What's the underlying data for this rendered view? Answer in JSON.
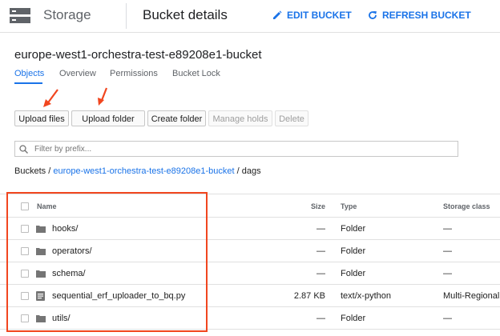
{
  "topbar": {
    "product_icon": "storage-icon",
    "product_label": "Storage",
    "page_title": "Bucket details",
    "edit_label": "EDIT BUCKET",
    "refresh_label": "REFRESH BUCKET"
  },
  "bucket": {
    "name": "europe-west1-orchestra-test-e89208e1-bucket"
  },
  "tabs": [
    {
      "label": "Objects",
      "active": true
    },
    {
      "label": "Overview",
      "active": false
    },
    {
      "label": "Permissions",
      "active": false
    },
    {
      "label": "Bucket Lock",
      "active": false
    }
  ],
  "actions": {
    "upload_files": "Upload files",
    "upload_folder": "Upload folder",
    "create_folder": "Create folder",
    "manage_holds": "Manage holds",
    "delete": "Delete"
  },
  "filter": {
    "placeholder": "Filter by prefix..."
  },
  "breadcrumb": {
    "root": "Buckets",
    "sep": "/",
    "bucket": "europe-west1-orchestra-test-e89208e1-bucket",
    "current": "dags"
  },
  "table": {
    "headers": {
      "name": "Name",
      "size": "Size",
      "type": "Type",
      "storage_class": "Storage class"
    },
    "rows": [
      {
        "icon": "folder-icon",
        "name": "hooks/",
        "size": "—",
        "type": "Folder",
        "storage_class": "—"
      },
      {
        "icon": "folder-icon",
        "name": "operators/",
        "size": "—",
        "type": "Folder",
        "storage_class": "—"
      },
      {
        "icon": "folder-icon",
        "name": "schema/",
        "size": "—",
        "type": "Folder",
        "storage_class": "—"
      },
      {
        "icon": "file-icon",
        "name": "sequential_erf_uploader_to_bq.py",
        "size": "2.87 KB",
        "type": "text/x-python",
        "storage_class": "Multi-Regional"
      },
      {
        "icon": "folder-icon",
        "name": "utils/",
        "size": "—",
        "type": "Folder",
        "storage_class": "—"
      }
    ]
  },
  "colors": {
    "accent": "#1a73e8",
    "annotation": "#f1461f"
  }
}
